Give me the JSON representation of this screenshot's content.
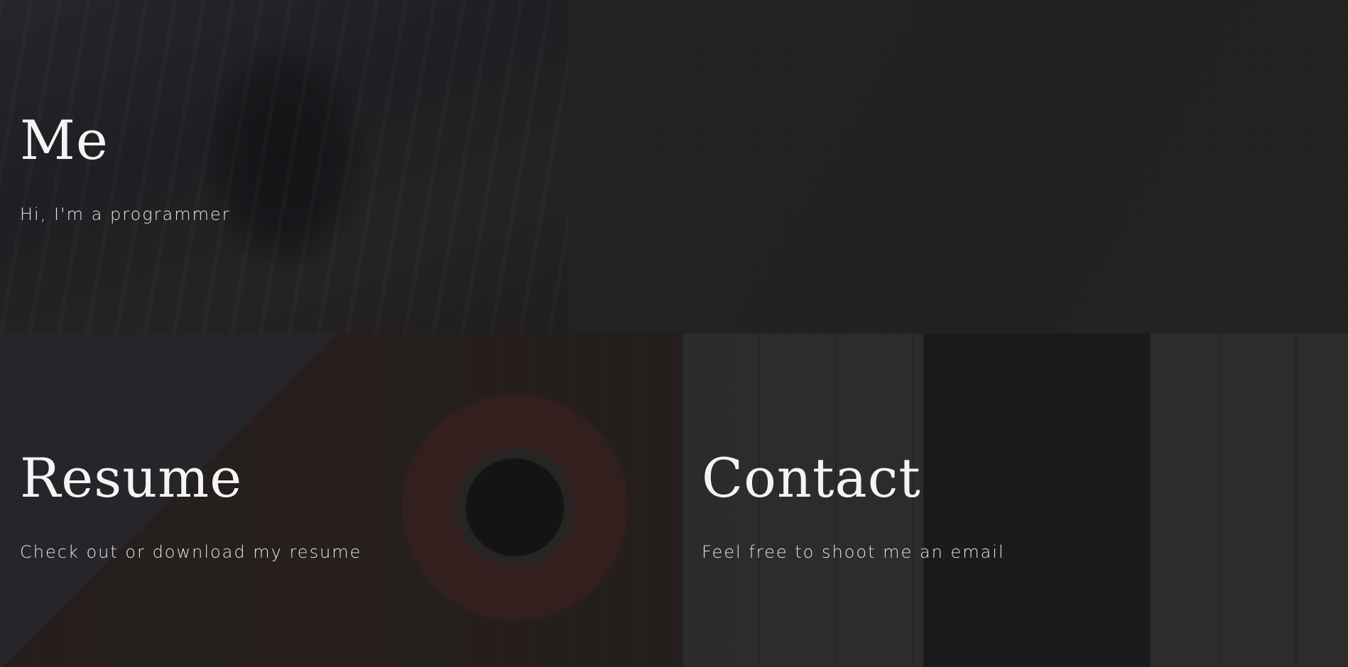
{
  "tiles": {
    "me": {
      "title": "Me",
      "subtitle": "Hi, I'm a programmer"
    },
    "resume": {
      "title": "Resume",
      "subtitle": "Check out or download my resume"
    },
    "contact": {
      "title": "Contact",
      "subtitle": "Feel free to shoot me an email"
    }
  },
  "colors": {
    "overlay": "#141416",
    "text": "#f2f2f2"
  }
}
